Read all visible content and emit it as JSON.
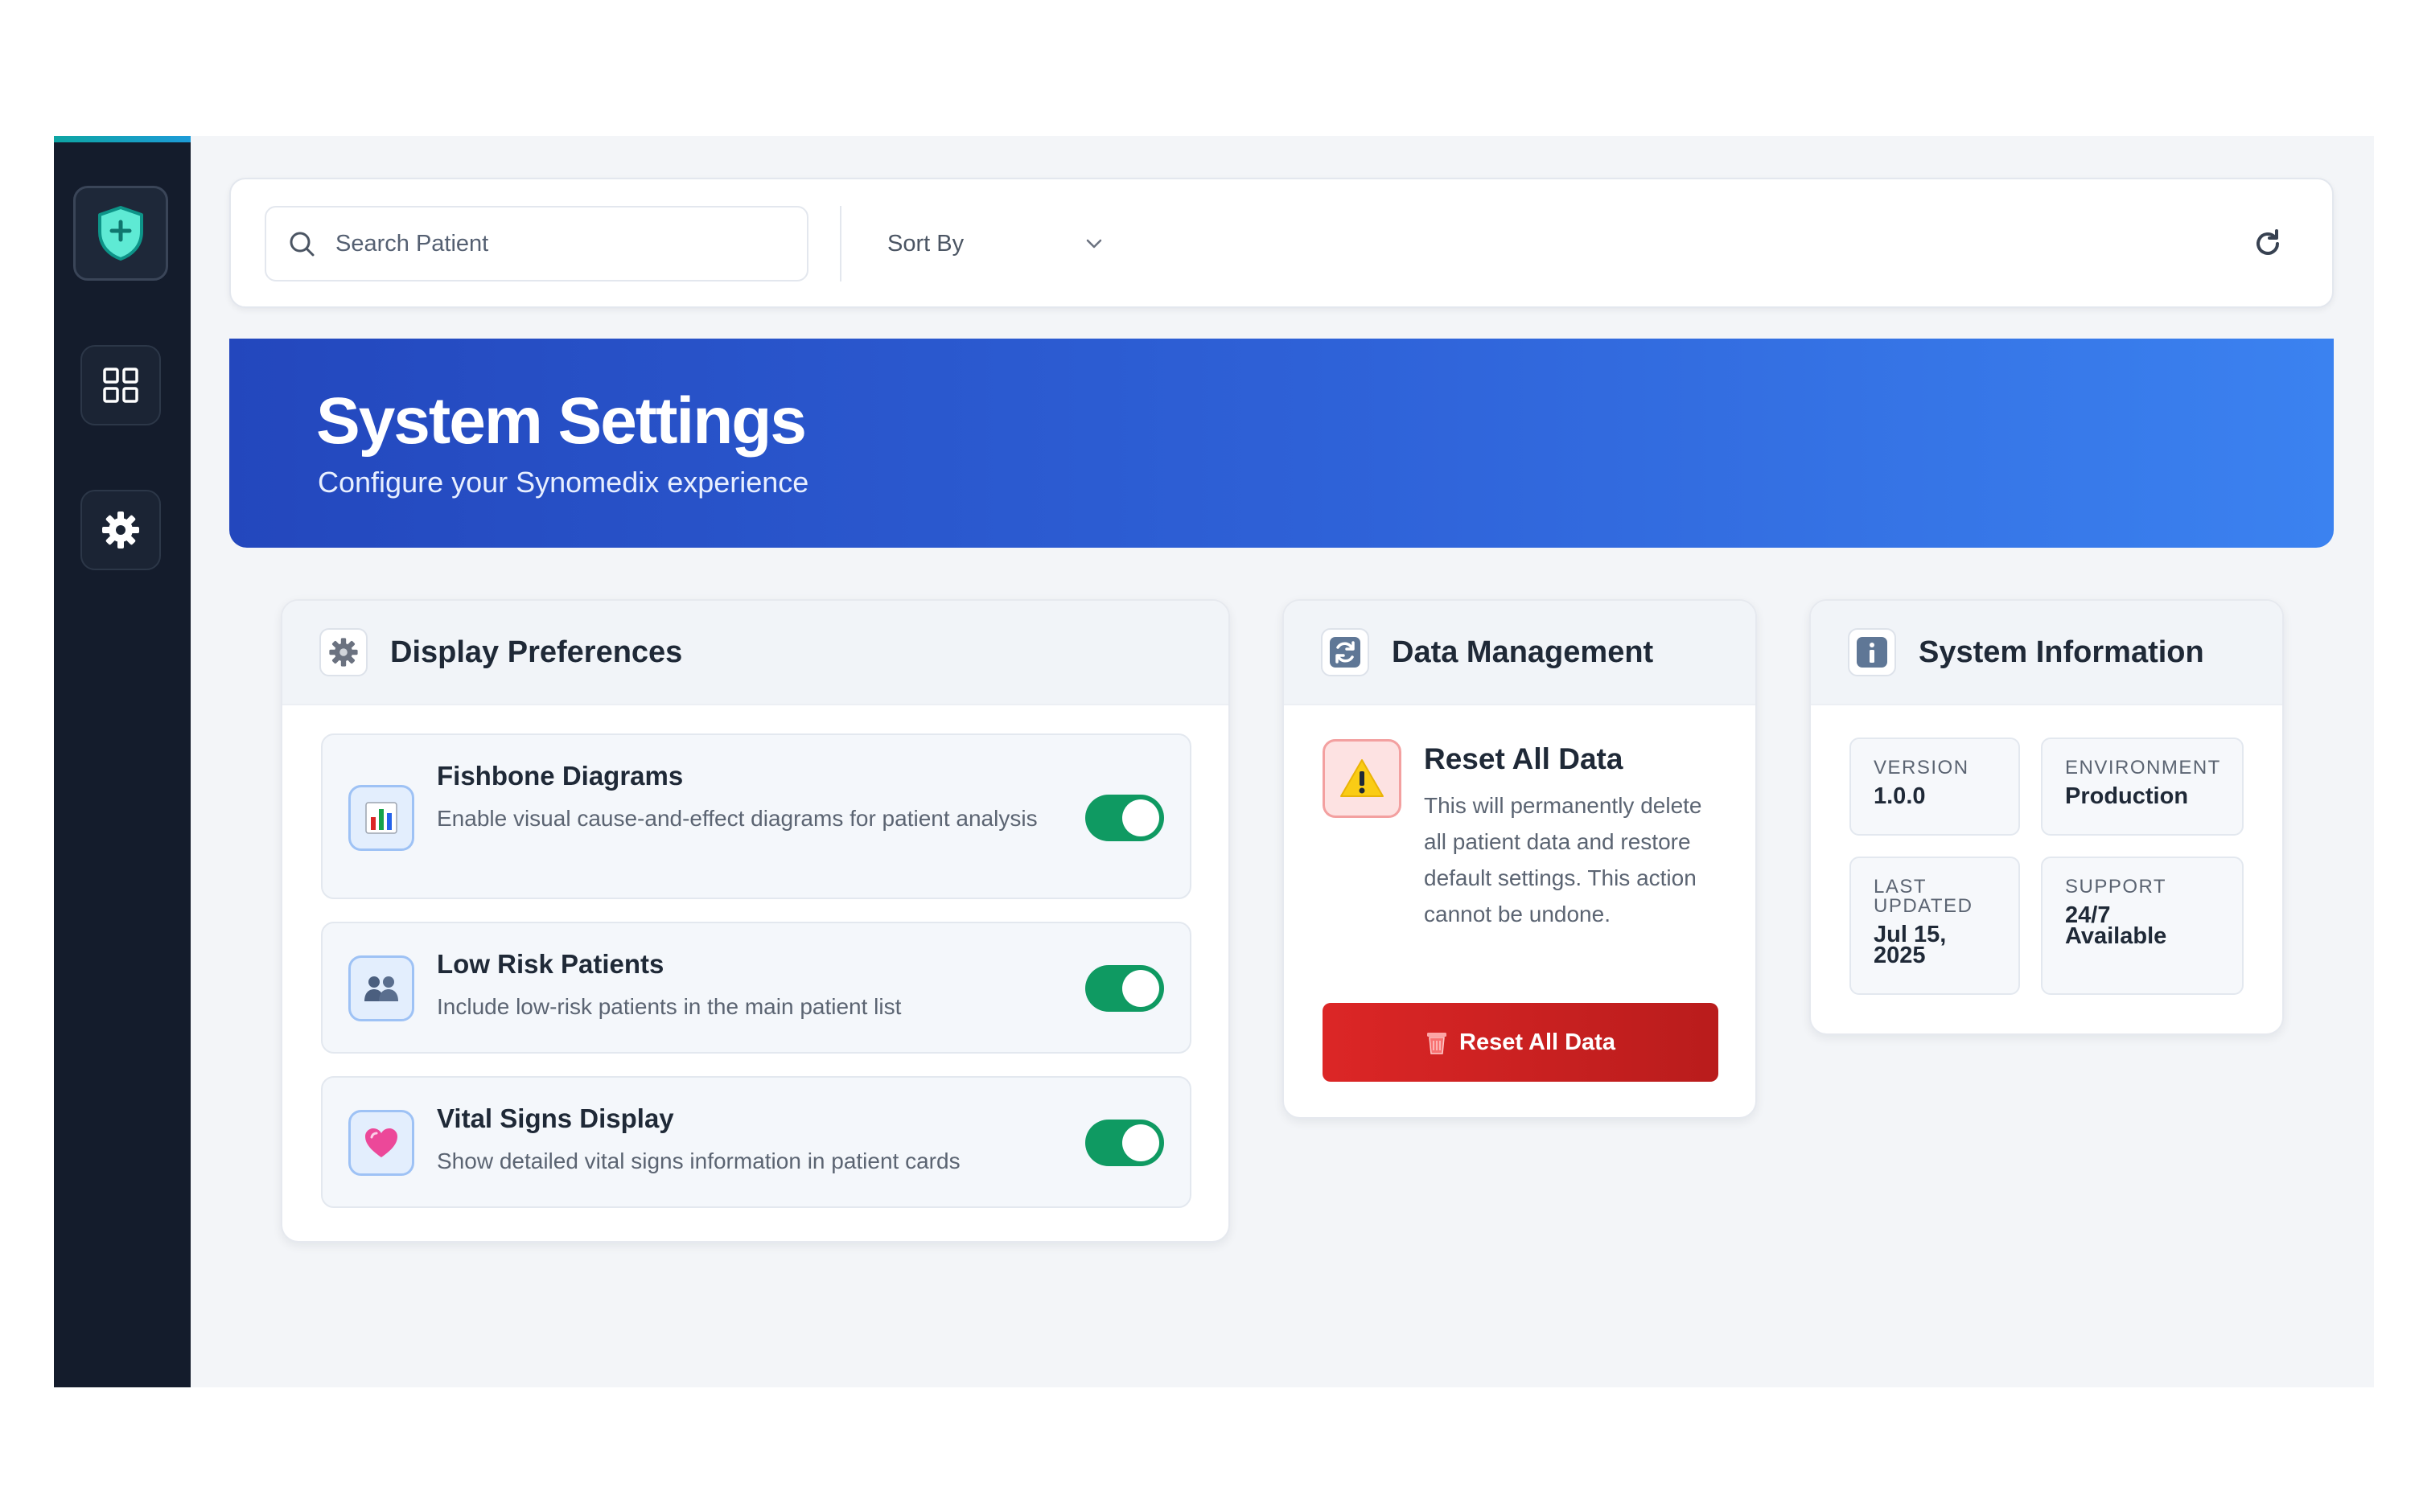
{
  "topbar": {
    "search_placeholder": "Search Patient",
    "sort_label": "Sort By"
  },
  "hero": {
    "title": "System Settings",
    "subtitle": "Configure your Synomedix experience"
  },
  "display_preferences": {
    "title": "Display Preferences",
    "items": [
      {
        "title": "Fishbone Diagrams",
        "description": "Enable visual cause-and-effect diagrams for patient analysis",
        "enabled": true
      },
      {
        "title": "Low Risk Patients",
        "description": "Include low-risk patients in the main patient list",
        "enabled": true
      },
      {
        "title": "Vital Signs Display",
        "description": "Show detailed vital signs information in patient cards",
        "enabled": true
      }
    ]
  },
  "data_management": {
    "title": "Data Management",
    "reset_title": "Reset All Data",
    "reset_description": "This will permanently delete all patient data and restore default settings. This action cannot be undone.",
    "reset_button": "Reset All Data"
  },
  "system_information": {
    "title": "System Information",
    "tiles": [
      {
        "label": "VERSION",
        "value": "1.0.0"
      },
      {
        "label": "ENVIRONMENT",
        "value": "Production"
      },
      {
        "label": "LAST UPDATED",
        "value": "Jul 15, 2025"
      },
      {
        "label": "SUPPORT",
        "value": "24/7 Available"
      }
    ]
  },
  "icons": {
    "logo": "shield-plus-icon",
    "dashboard": "grid-icon",
    "settings": "gear-icon",
    "search": "search-icon",
    "sort": "chevron-down-icon",
    "refresh": "refresh-icon"
  },
  "colors": {
    "sidebar": "#141c2c",
    "accent_green": "#0f9a62",
    "hero_start": "#2347bd",
    "hero_end": "#3b82f0",
    "danger": "#dc2626"
  }
}
